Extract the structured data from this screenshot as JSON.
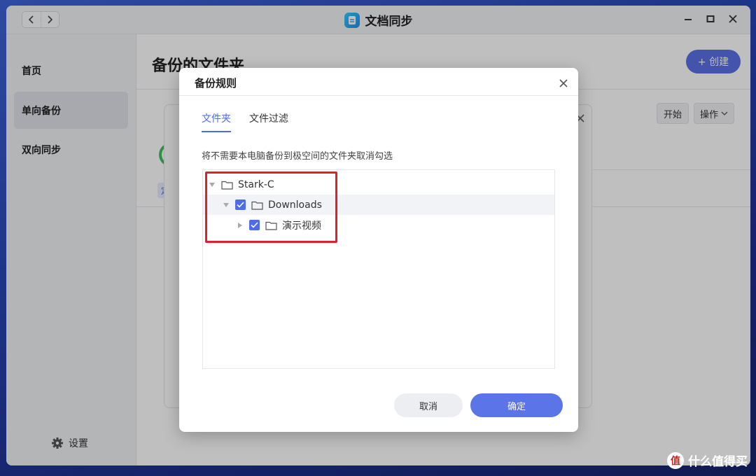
{
  "app": {
    "title": "文档同步",
    "nav": {
      "back_icon": "chevron-left-icon",
      "forward_icon": "chevron-right-icon"
    }
  },
  "sidebar": {
    "items": [
      {
        "label": "首页"
      },
      {
        "label": "单向备份",
        "active": true
      },
      {
        "label": "双向同步"
      }
    ],
    "settings_label": "设置"
  },
  "main": {
    "title": "备份的文件夹",
    "create_label": "+ 创建",
    "start_label": "开始",
    "action_label": "操作",
    "tag_text": "定"
  },
  "dialog": {
    "title": "备份规则",
    "tabs": [
      {
        "label": "文件夹",
        "active": true
      },
      {
        "label": "文件过滤",
        "active": false
      }
    ],
    "hint": "将不需要本电脑备份到极空间的文件夹取消勾选",
    "tree": [
      {
        "label": "Stark-C",
        "level": 0,
        "expanded": true,
        "checked": null
      },
      {
        "label": "Downloads",
        "level": 1,
        "expanded": true,
        "checked": true
      },
      {
        "label": "演示视频",
        "level": 2,
        "expanded": false,
        "checked": true
      }
    ],
    "cancel_label": "取消",
    "ok_label": "确定"
  },
  "watermark": {
    "text": "什么值得买",
    "logo_text": "值"
  },
  "colors": {
    "accent": "#4d6bea",
    "highlight_box": "#e0202c",
    "create_button": "#5b6fe6"
  }
}
